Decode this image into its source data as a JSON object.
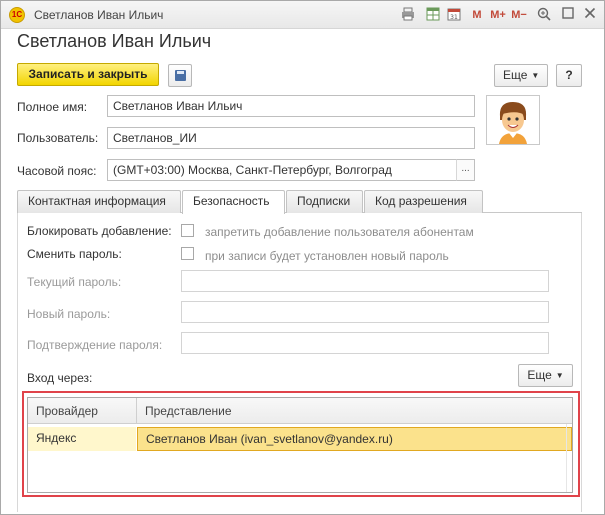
{
  "window": {
    "title": "Светланов Иван Ильич",
    "app_logo_text": "1С",
    "title_icons": [
      "print-icon",
      "table-icon",
      "calendar-icon",
      "M",
      "M+",
      "M−",
      "zoom-icon",
      "minimize-icon",
      "maximize-icon",
      "close-icon"
    ],
    "memory_labels": {
      "m": "M",
      "m_plus": "M+",
      "m_minus": "M−"
    }
  },
  "form": {
    "heading": "Светланов Иван Ильич"
  },
  "toolbar": {
    "save_close_label": "Записать и закрыть",
    "more_label": "Еще",
    "help_label": "?"
  },
  "fields": {
    "full_name_label": "Полное имя:",
    "full_name_value": "Светланов Иван Ильич",
    "user_label": "Пользователь:",
    "user_value": "Светланов_ИИ",
    "timezone_label": "Часовой пояс:",
    "timezone_value": "(GMT+03:00) Москва, Санкт-Петербург, Волгоград",
    "timezone_button": "..."
  },
  "tabs": [
    {
      "label": "Контактная информация",
      "active": false
    },
    {
      "label": "Безопасность",
      "active": true
    },
    {
      "label": "Подписки",
      "active": false
    },
    {
      "label": "Код разрешения",
      "active": false
    }
  ],
  "security": {
    "block_add_label": "Блокировать добавление:",
    "block_add_text": "запретить добавление пользователя абонентам",
    "change_pwd_label": "Сменить пароль:",
    "change_pwd_text": "при записи будет установлен новый пароль",
    "current_pwd_label": "Текущий пароль:",
    "new_pwd_label": "Новый пароль:",
    "confirm_pwd_label": "Подтверждение пароля:",
    "login_via_label": "Вход через:",
    "more_label": "Еще"
  },
  "providers_table": {
    "columns": [
      "Провайдер",
      "Представление"
    ],
    "rows": [
      {
        "provider": "Яндекс",
        "representation": "Светланов Иван (ivan_svetlanov@yandex.ru)"
      }
    ]
  },
  "colors": {
    "primary_button": "#f2d500",
    "highlight_frame": "#e0434a",
    "selected_cell": "#fbe28c"
  }
}
